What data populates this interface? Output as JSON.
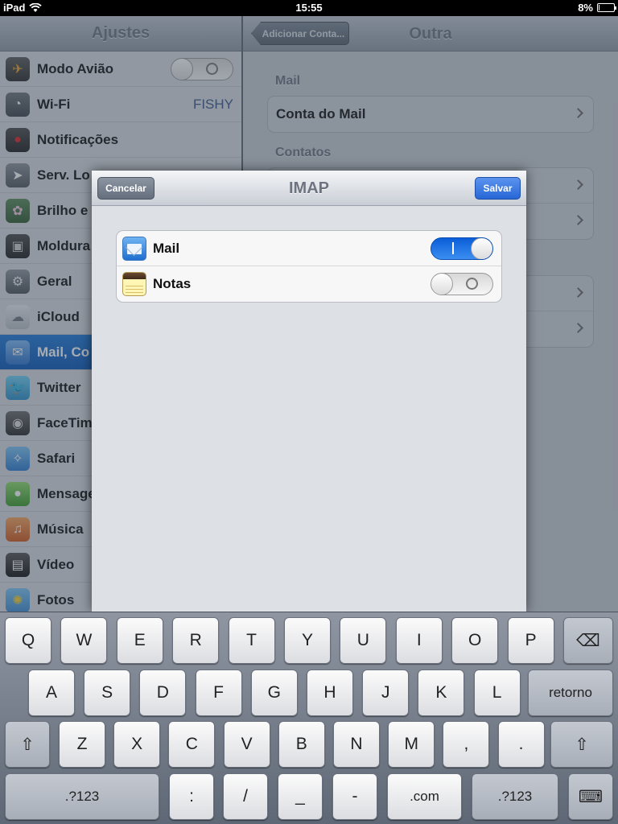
{
  "status_bar": {
    "device": "iPad",
    "time": "15:55",
    "battery": "8%",
    "battery_level": 0.08
  },
  "master": {
    "title": "Ajustes",
    "items": [
      {
        "label": "Modo Avião",
        "icon": "airplane-icon",
        "toggle": "off"
      },
      {
        "label": "Wi-Fi",
        "icon": "wifi-icon",
        "value": "FISHY"
      },
      {
        "label": "Notificações",
        "icon": "notifications-icon"
      },
      {
        "label": "Serv. Lo",
        "icon": "location-icon"
      },
      {
        "label": "Brilho e",
        "icon": "brightness-icon"
      },
      {
        "label": "Moldura",
        "icon": "picture-frame-icon"
      },
      {
        "label": "Geral",
        "icon": "gear-icon"
      },
      {
        "label": "iCloud",
        "icon": "cloud-icon"
      },
      {
        "label": "Mail, Co",
        "icon": "mail-icon",
        "selected": true
      },
      {
        "label": "Twitter",
        "icon": "twitter-icon"
      },
      {
        "label": "FaceTim",
        "icon": "facetime-icon"
      },
      {
        "label": "Safari",
        "icon": "compass-icon"
      },
      {
        "label": "Mensage",
        "icon": "messages-icon"
      },
      {
        "label": "Música",
        "icon": "music-icon"
      },
      {
        "label": "Vídeo",
        "icon": "video-icon"
      },
      {
        "label": "Fotos",
        "icon": "photos-icon"
      }
    ]
  },
  "detail": {
    "title": "Outra",
    "back_label": "Adicionar Conta...",
    "sections": [
      {
        "label": "Mail",
        "rows": [
          "Conta do Mail"
        ]
      },
      {
        "label": "Contatos",
        "rows": [
          "",
          ""
        ]
      },
      {
        "label": "",
        "rows": [
          "",
          ""
        ]
      }
    ]
  },
  "modal": {
    "title": "IMAP",
    "cancel_label": "Cancelar",
    "save_label": "Salvar",
    "rows": [
      {
        "label": "Mail",
        "icon": "mail-app-icon",
        "toggle": "on"
      },
      {
        "label": "Notas",
        "icon": "notes-app-icon",
        "toggle": "off"
      }
    ]
  },
  "keyboard": {
    "row1": [
      "Q",
      "W",
      "E",
      "R",
      "T",
      "Y",
      "U",
      "I",
      "O",
      "P"
    ],
    "row2": [
      "A",
      "S",
      "D",
      "F",
      "G",
      "H",
      "J",
      "K",
      "L"
    ],
    "return_label": "retorno",
    "row3": [
      "Z",
      "X",
      "C",
      "V",
      "B",
      "N",
      "M",
      ",",
      "."
    ],
    "row4": [
      ".?123",
      ":",
      "/",
      "_",
      "-",
      ".com",
      ".?123"
    ]
  },
  "colors": {
    "accent": "#0a57b8",
    "save_button": "#2767d6"
  }
}
